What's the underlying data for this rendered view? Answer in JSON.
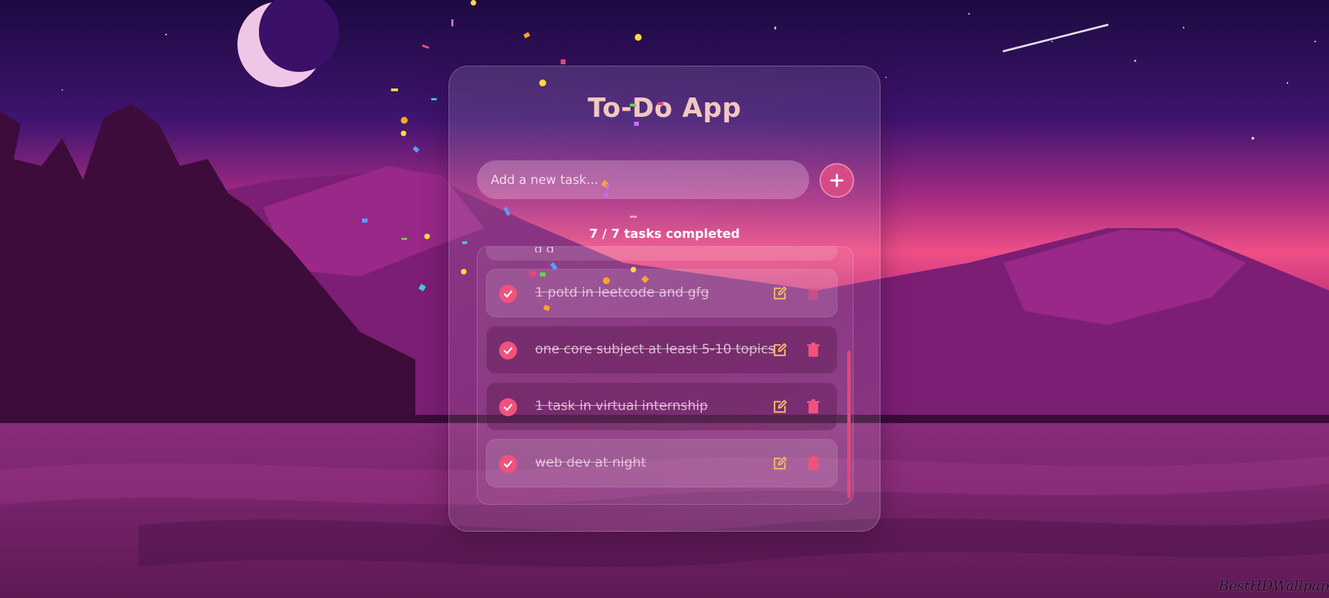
{
  "app": {
    "title": "To-Do App"
  },
  "input": {
    "placeholder": "Add a new task...",
    "value": ""
  },
  "progress_text": "7 / 7 tasks completed",
  "tasks": [
    {
      "text": "1 potd in leetcode and gfg",
      "completed": true
    },
    {
      "text": "one core subject at least 5-10 topics",
      "completed": true
    },
    {
      "text": "1 task in virtual internship",
      "completed": true
    },
    {
      "text": "web dev at night",
      "completed": true
    }
  ],
  "partial_task": {
    "text": "g g",
    "completed": true
  },
  "icons": {
    "add": "plus-icon",
    "check": "check-icon",
    "edit": "edit-icon",
    "delete": "trash-icon"
  },
  "colors": {
    "accent": "#f0527e",
    "edit": "#f2b36b",
    "delete": "#f0527e",
    "title": "#f3c7c0"
  },
  "watermark": "BestHDWallpap"
}
